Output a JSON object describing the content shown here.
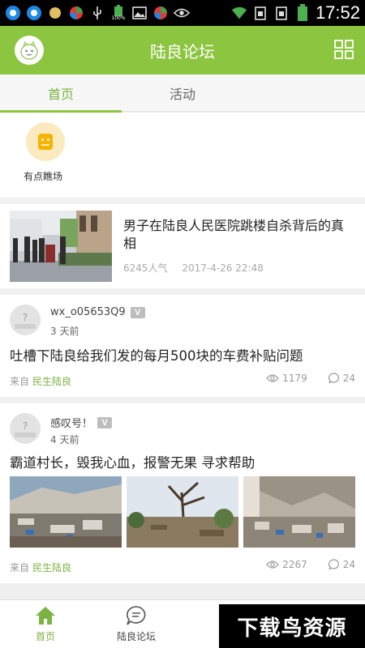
{
  "status_bar": {
    "time": "17:52",
    "battery_label": "100%",
    "icons": [
      "qq-icon",
      "qq-icon",
      "circle-icon",
      "app-icon",
      "usb-icon",
      "battery-icon",
      "image-icon",
      "app-icon",
      "eye-icon",
      "wifi-icon",
      "sim-icon",
      "sim-icon",
      "battery-icon"
    ]
  },
  "header": {
    "title": "陆良论坛"
  },
  "tabs": [
    {
      "label": "首页",
      "active": true
    },
    {
      "label": "活动",
      "active": false
    }
  ],
  "categories": [
    {
      "label": "有点瞧场",
      "icon": "robot-icon"
    }
  ],
  "news": {
    "title": "男子在陆良人民医院跳楼自杀背后的真相",
    "views": "6245人气",
    "time": "2017-4-26 22:48"
  },
  "posts": [
    {
      "user": "wx_o05653Q9",
      "badge": "V",
      "time": "3 天前",
      "title": "吐槽下陆良给我们发的每月500块的车费补贴问题",
      "from_prefix": "来自",
      "source": "民生陆良",
      "views": "1179",
      "comments": "24"
    },
    {
      "user": "感叹号！",
      "badge": "V",
      "time": "4 天前",
      "title": "霸道村长，毁我心血，报警无果 寻求帮助",
      "from_prefix": "来自",
      "source": "民生陆良",
      "views": "2267",
      "comments": "24"
    }
  ],
  "bottom_nav": [
    {
      "label": "首页",
      "icon": "home-icon",
      "active": true
    },
    {
      "label": "陆良论坛",
      "icon": "chat-icon",
      "active": false
    }
  ],
  "watermark": "下载鸟资源",
  "colors": {
    "accent": "#8cc53f",
    "accent_text": "#7cb342"
  }
}
